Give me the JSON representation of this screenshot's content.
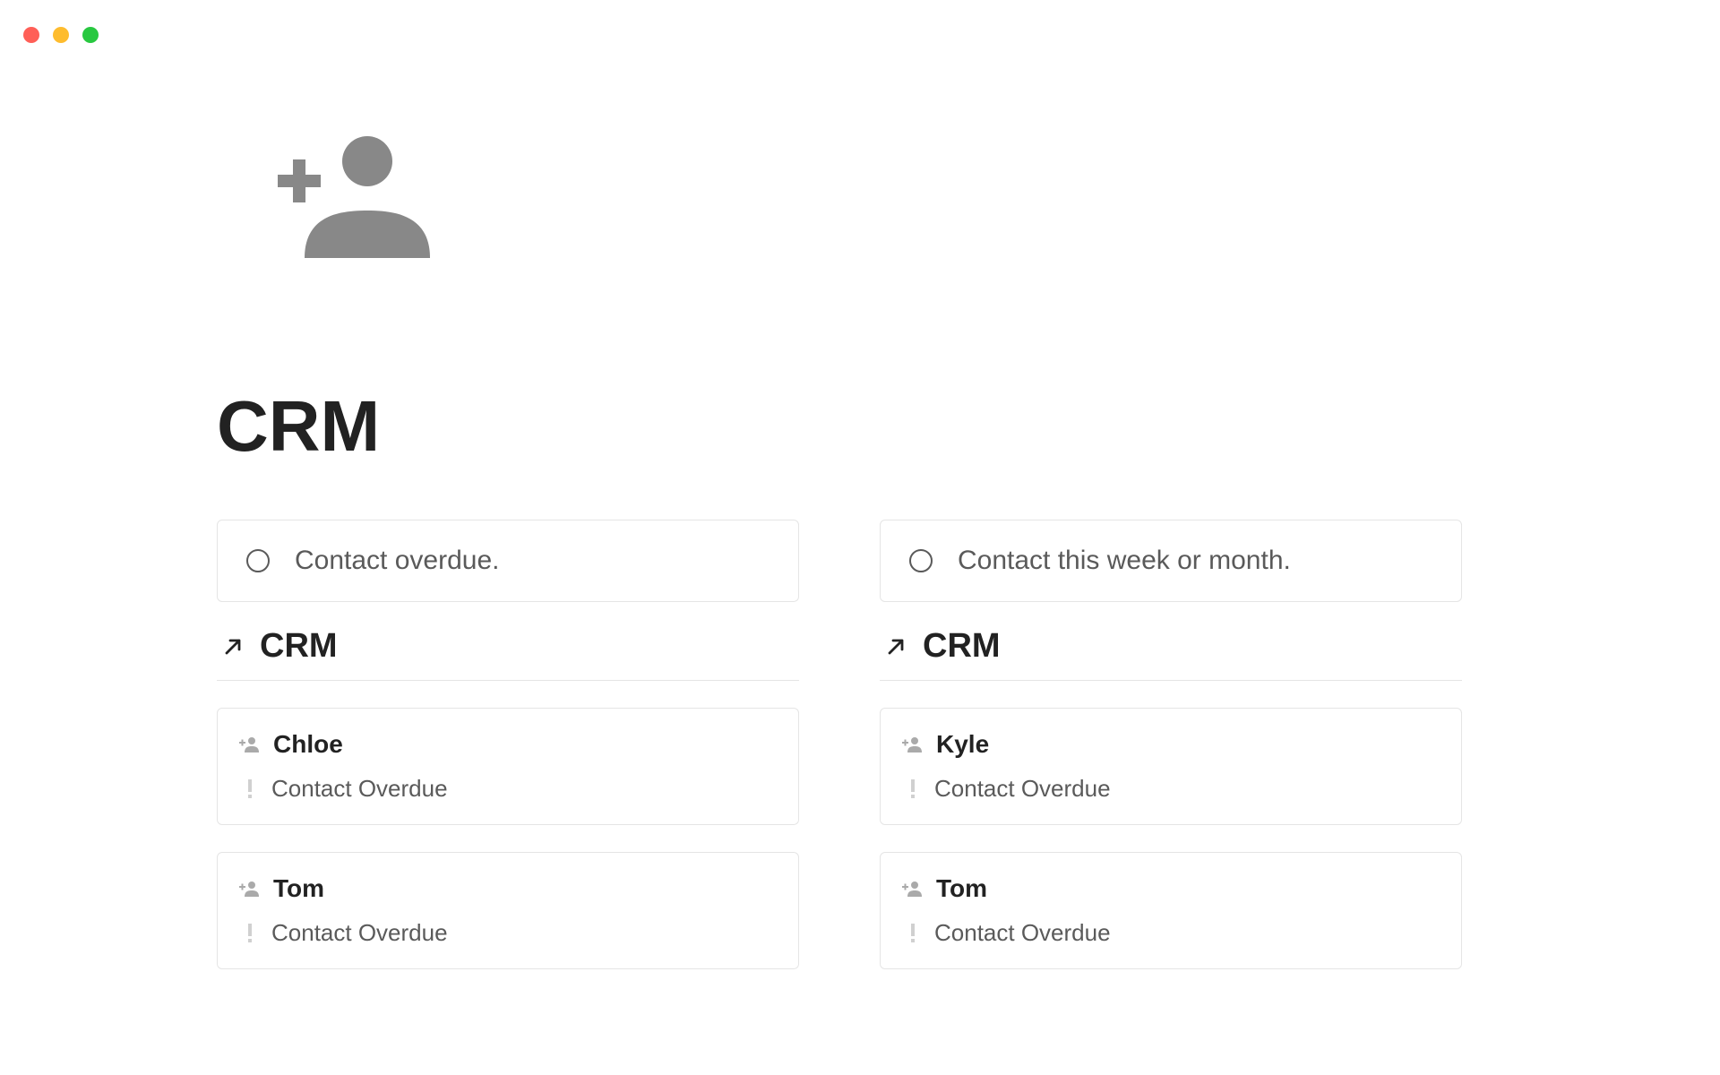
{
  "page": {
    "title": "CRM"
  },
  "columns": [
    {
      "callout": "Contact overdue.",
      "link": "CRM",
      "cards": [
        {
          "name": "Chloe",
          "status": "Contact Overdue"
        },
        {
          "name": "Tom",
          "status": "Contact Overdue"
        }
      ]
    },
    {
      "callout": "Contact this week or month.",
      "link": "CRM",
      "cards": [
        {
          "name": "Kyle",
          "status": "Contact Overdue"
        },
        {
          "name": "Tom",
          "status": "Contact Overdue"
        }
      ]
    }
  ]
}
